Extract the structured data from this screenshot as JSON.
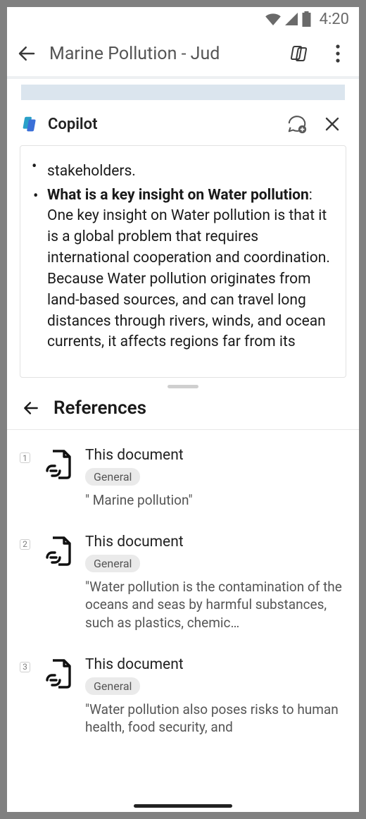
{
  "status": {
    "time": "4:20"
  },
  "header": {
    "title": "Marine Pollution - Jud"
  },
  "copilot": {
    "title": "Copilot",
    "message": {
      "trailing_prev": "stakeholders.",
      "bullet_bold": "What is a key insight on Water pollution",
      "bullet_text": ": One key insight on Water pollution is that it is a global problem that requires international cooperation and coordination. Because Water pollution originates from land-based sources, and can travel long distances through rivers, winds, and ocean currents, it affects regions far from its"
    }
  },
  "references": {
    "title": "References",
    "items": [
      {
        "index": "1",
        "title": "This document",
        "badge": "General",
        "quote": "\" Marine pollution\""
      },
      {
        "index": "2",
        "title": "This document",
        "badge": "General",
        "quote": "\"Water pollution is the contamination of the oceans and seas by harmful substances, such as plastics, chemic…"
      },
      {
        "index": "3",
        "title": "This document",
        "badge": "General",
        "quote": "\"Water pollution also poses risks to human health, food security, and"
      }
    ]
  }
}
